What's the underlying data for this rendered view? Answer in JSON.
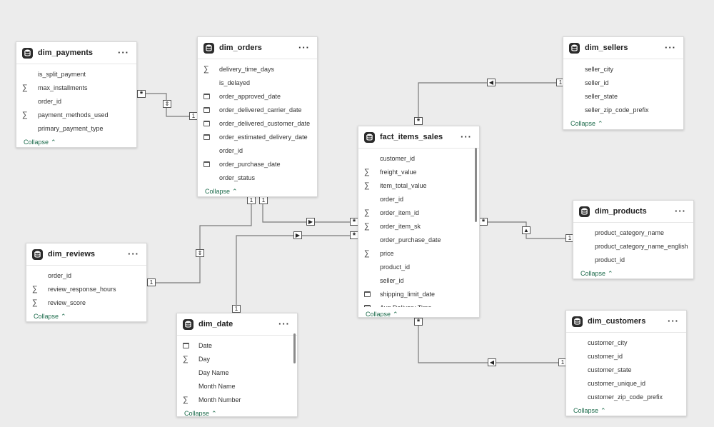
{
  "tables": {
    "dim_payments": {
      "title": "dim_payments",
      "more": "···",
      "collapse": "Collapse",
      "fields": [
        {
          "name": "is_split_payment",
          "icon": "none"
        },
        {
          "name": "max_installments",
          "icon": "sigma"
        },
        {
          "name": "order_id",
          "icon": "none"
        },
        {
          "name": "payment_methods_used",
          "icon": "sigma"
        },
        {
          "name": "primary_payment_type",
          "icon": "none"
        }
      ]
    },
    "dim_orders": {
      "title": "dim_orders",
      "more": "···",
      "collapse": "Collapse",
      "fields": [
        {
          "name": "delivery_time_days",
          "icon": "sigma"
        },
        {
          "name": "is_delayed",
          "icon": "none"
        },
        {
          "name": "order_approved_date",
          "icon": "calendar"
        },
        {
          "name": "order_delivered_carrier_date",
          "icon": "calendar"
        },
        {
          "name": "order_delivered_customer_date",
          "icon": "calendar"
        },
        {
          "name": "order_estimated_delivery_date",
          "icon": "calendar"
        },
        {
          "name": "order_id",
          "icon": "none"
        },
        {
          "name": "order_purchase_date",
          "icon": "calendar"
        },
        {
          "name": "order_status",
          "icon": "none"
        }
      ]
    },
    "dim_sellers": {
      "title": "dim_sellers",
      "more": "···",
      "collapse": "Collapse",
      "fields": [
        {
          "name": "seller_city",
          "icon": "none"
        },
        {
          "name": "seller_id",
          "icon": "none"
        },
        {
          "name": "seller_state",
          "icon": "none"
        },
        {
          "name": "seller_zip_code_prefix",
          "icon": "none"
        }
      ]
    },
    "fact_items_sales": {
      "title": "fact_items_sales",
      "more": "···",
      "collapse": "Collapse",
      "fields": [
        {
          "name": "customer_id",
          "icon": "none"
        },
        {
          "name": "freight_value",
          "icon": "sigma"
        },
        {
          "name": "item_total_value",
          "icon": "sigma"
        },
        {
          "name": "order_id",
          "icon": "none"
        },
        {
          "name": "order_item_id",
          "icon": "sigma"
        },
        {
          "name": "order_item_sk",
          "icon": "sigma"
        },
        {
          "name": "order_purchase_date",
          "icon": "none"
        },
        {
          "name": "price",
          "icon": "sigma"
        },
        {
          "name": "product_id",
          "icon": "none"
        },
        {
          "name": "seller_id",
          "icon": "none"
        },
        {
          "name": "shipping_limit_date",
          "icon": "calendar"
        },
        {
          "name": "Avg Delivery Time",
          "icon": "calendar"
        }
      ]
    },
    "dim_products": {
      "title": "dim_products",
      "more": "···",
      "collapse": "Collapse",
      "fields": [
        {
          "name": "product_category_name",
          "icon": "none"
        },
        {
          "name": "product_category_name_english",
          "icon": "none"
        },
        {
          "name": "product_id",
          "icon": "none"
        }
      ]
    },
    "dim_reviews": {
      "title": "dim_reviews",
      "more": "···",
      "collapse": "Collapse",
      "fields": [
        {
          "name": "order_id",
          "icon": "none"
        },
        {
          "name": "review_response_hours",
          "icon": "sigma"
        },
        {
          "name": "review_score",
          "icon": "sigma"
        }
      ]
    },
    "dim_date": {
      "title": "dim_date",
      "more": "···",
      "collapse": "Collapse",
      "fields": [
        {
          "name": "Date",
          "icon": "calendar"
        },
        {
          "name": "Day",
          "icon": "sigma"
        },
        {
          "name": "Day Name",
          "icon": "none"
        },
        {
          "name": "Month Name",
          "icon": "none"
        },
        {
          "name": "Month Number",
          "icon": "sigma"
        }
      ]
    },
    "dim_customers": {
      "title": "dim_customers",
      "more": "···",
      "collapse": "Collapse",
      "fields": [
        {
          "name": "customer_city",
          "icon": "none"
        },
        {
          "name": "customer_id",
          "icon": "none"
        },
        {
          "name": "customer_state",
          "icon": "none"
        },
        {
          "name": "customer_unique_id",
          "icon": "none"
        },
        {
          "name": "customer_zip_code_prefix",
          "icon": "none"
        }
      ]
    }
  },
  "relationships": {
    "one": "1",
    "many": "*",
    "filter_single_left": "◀",
    "filter_single_right": "▶",
    "filter_single_up": "▲",
    "filter_both": "⇕"
  },
  "colors": {
    "canvas": "#ececec",
    "line": "#7a7a7a",
    "collapse_link": "#1c6b4b"
  }
}
